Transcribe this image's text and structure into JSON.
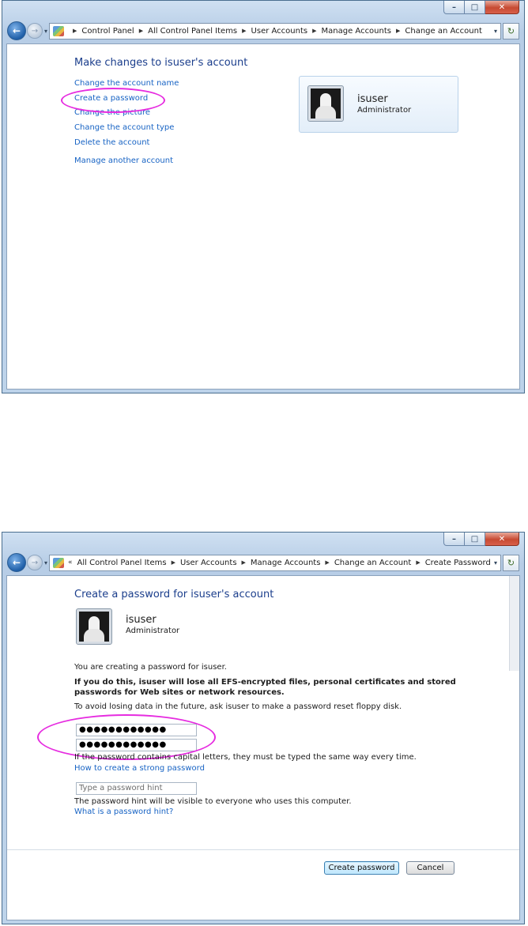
{
  "window1": {
    "address": [
      "Control Panel",
      "All Control Panel Items",
      "User Accounts",
      "Manage Accounts",
      "Change an Account"
    ],
    "heading": "Make changes to isuser's account",
    "links": [
      "Change the account name",
      "Create a password",
      "Change the picture",
      "Change the account type",
      "Delete the account"
    ],
    "manage_link": "Manage another account",
    "user": {
      "name": "isuser",
      "role": "Administrator"
    }
  },
  "window2": {
    "address": [
      "All Control Panel Items",
      "User Accounts",
      "Manage Accounts",
      "Change an Account",
      "Create Password"
    ],
    "heading": "Create a password for isuser's account",
    "user": {
      "name": "isuser",
      "role": "Administrator"
    },
    "intro": "You are creating a password for isuser.",
    "warning": "If you do this, isuser will lose all EFS-encrypted files, personal certificates and stored passwords for Web sites or network resources.",
    "reset_note": "To avoid losing data in the future, ask isuser to make a password reset floppy disk.",
    "password_value": "●●●●●●●●●●●●",
    "confirm_value": "●●●●●●●●●●●●",
    "caps_note": "If the password contains capital letters, they must be typed the same way every time.",
    "strong_link": "How to create a strong password",
    "hint_placeholder": "Type a password hint",
    "hint_note": "The password hint will be visible to everyone who uses this computer.",
    "hint_link": "What is a password hint?",
    "create_button": "Create password",
    "cancel_button": "Cancel"
  },
  "window_controls": {
    "minimize": "–",
    "maximize": "□",
    "close": "✕"
  },
  "colors": {
    "highlight": "#e62ce0",
    "link": "#1763c4",
    "heading": "#1b3e8c"
  }
}
